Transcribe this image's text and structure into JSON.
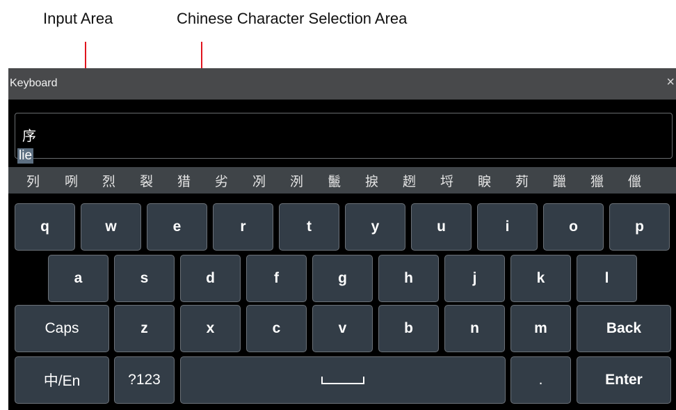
{
  "annotations": {
    "input_area": "Input Area",
    "selection_area": "Chinese Character Selection Area"
  },
  "window": {
    "title": "Keyboard",
    "close_icon": "×"
  },
  "input": {
    "text": "序",
    "composition": "lie"
  },
  "candidates": [
    "列",
    "咧",
    "烈",
    "裂",
    "猎",
    "劣",
    "冽",
    "洌",
    "鬛",
    "捩",
    "趔",
    "埒",
    "睙",
    "茢",
    "躐",
    "獵",
    "儠"
  ],
  "keys": {
    "row1": [
      "q",
      "w",
      "e",
      "r",
      "t",
      "y",
      "u",
      "i",
      "o",
      "p"
    ],
    "row2": [
      "a",
      "s",
      "d",
      "f",
      "g",
      "h",
      "j",
      "k",
      "l"
    ],
    "row3": {
      "caps": "Caps",
      "letters": [
        "z",
        "x",
        "c",
        "v",
        "b",
        "n",
        "m"
      ],
      "back": "Back"
    },
    "row4": {
      "lang": "中/En",
      "symbols": "?123",
      "period": ".",
      "enter": "Enter"
    }
  },
  "colors": {
    "arrow": "#e0141e",
    "key_bg": "#333d47",
    "candidate_bar": "#3f4448",
    "title_bar": "#48494b"
  }
}
